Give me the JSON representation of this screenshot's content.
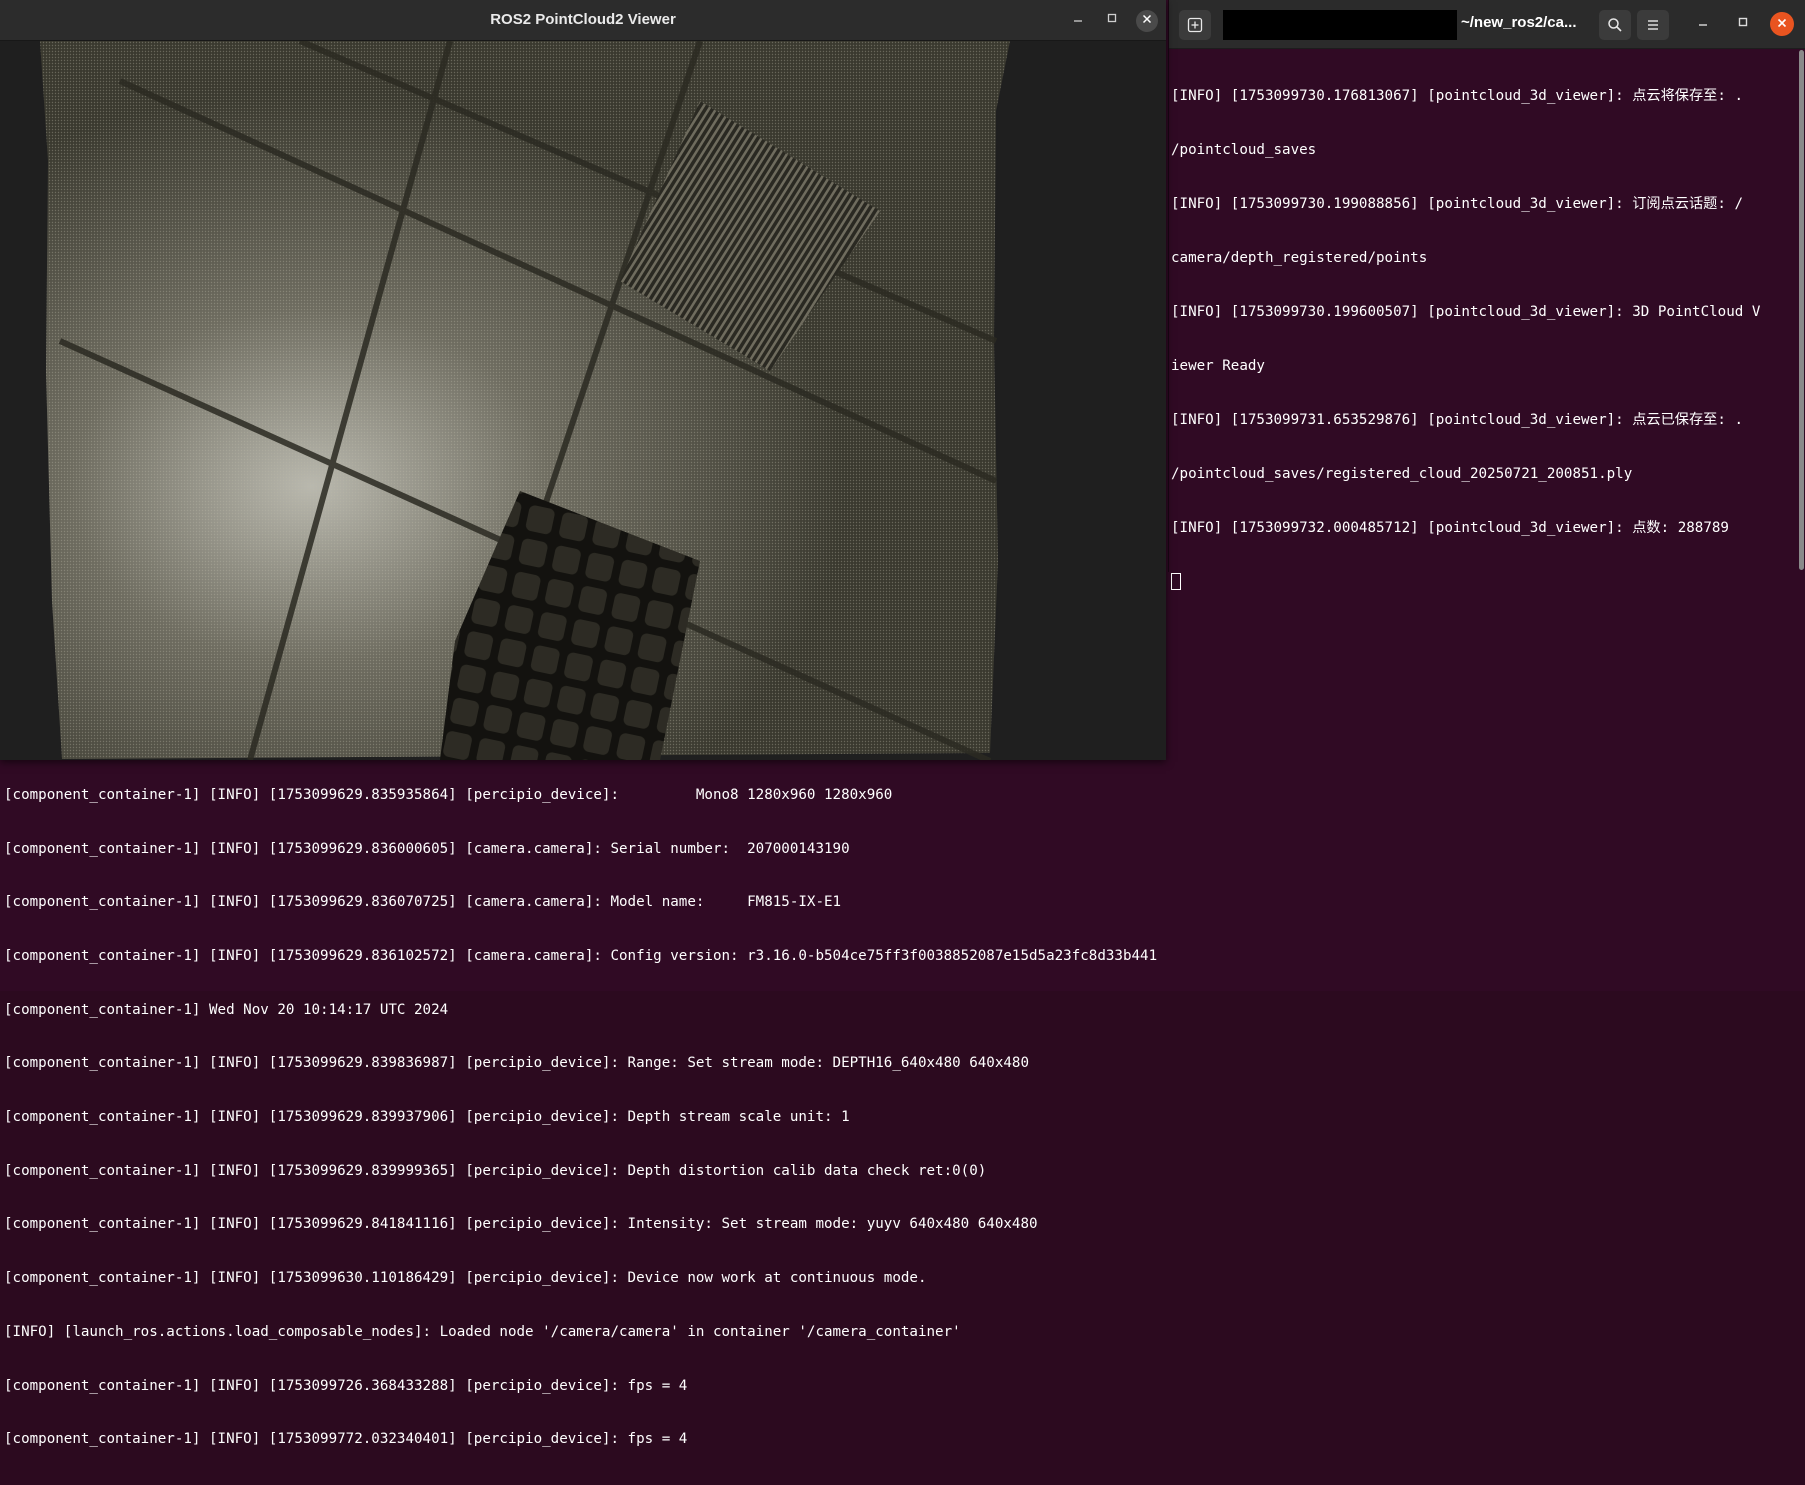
{
  "bottom_terminal": {
    "lines": [
      "[component_container-1] [INFO] [1753099629.835935864] [percipio_device]:         Mono8 1280x960 1280x960",
      "[component_container-1] [INFO] [1753099629.836000605] [camera.camera]: Serial number:  207000143190",
      "[component_container-1] [INFO] [1753099629.836070725] [camera.camera]: Model name:     FM815-IX-E1",
      "[component_container-1] [INFO] [1753099629.836102572] [camera.camera]: Config version: r3.16.0-b504ce75ff3f0038852087e15d5a23fc8d33b441",
      "[component_container-1] Wed Nov 20 10:14:17 UTC 2024",
      "[component_container-1] [INFO] [1753099629.839836987] [percipio_device]: Range: Set stream mode: DEPTH16_640x480 640x480",
      "[component_container-1] [INFO] [1753099629.839937906] [percipio_device]: Depth stream scale unit: 1",
      "[component_container-1] [INFO] [1753099629.839999365] [percipio_device]: Depth distortion calib data check ret:0(0)",
      "[component_container-1] [INFO] [1753099629.841841116] [percipio_device]: Intensity: Set stream mode: yuyv 640x480 640x480",
      "[component_container-1] [INFO] [1753099630.110186429] [percipio_device]: Device now work at continuous mode.",
      "[INFO] [launch_ros.actions.load_composable_nodes]: Loaded node '/camera/camera' in container '/camera_container'",
      "[component_container-1] [INFO] [1753099726.368433288] [percipio_device]: fps = 4",
      "[component_container-1] [INFO] [1753099772.032340401] [percipio_device]: fps = 4"
    ]
  },
  "right_terminal": {
    "title": "~/new_ros2/ca...",
    "lines": [
      "[INFO] [1753099730.176813067] [pointcloud_3d_viewer]: 点云将保存至: .",
      "/pointcloud_saves",
      "[INFO] [1753099730.199088856] [pointcloud_3d_viewer]: 订阅点云话题: /",
      "camera/depth_registered/points",
      "[INFO] [1753099730.199600507] [pointcloud_3d_viewer]: 3D PointCloud V",
      "iewer Ready",
      "[INFO] [1753099731.653529876] [pointcloud_3d_viewer]: 点云已保存至: .",
      "/pointcloud_saves/registered_cloud_20250721_200851.ply",
      "[INFO] [1753099732.000485712] [pointcloud_3d_viewer]: 点数: 288789"
    ],
    "icons": {
      "new_tab": "new-tab-icon",
      "search": "search-icon",
      "menu": "hamburger-menu-icon",
      "minimize": "minimize-icon",
      "maximize": "maximize-icon",
      "close": "close-icon"
    },
    "colors": {
      "background": "#300a24",
      "close": "#e95420"
    }
  },
  "viewer": {
    "title": "ROS2 PointCloud2 Viewer",
    "icons": {
      "minimize": "minimize-icon",
      "maximize": "maximize-icon",
      "close": "close-icon"
    }
  }
}
